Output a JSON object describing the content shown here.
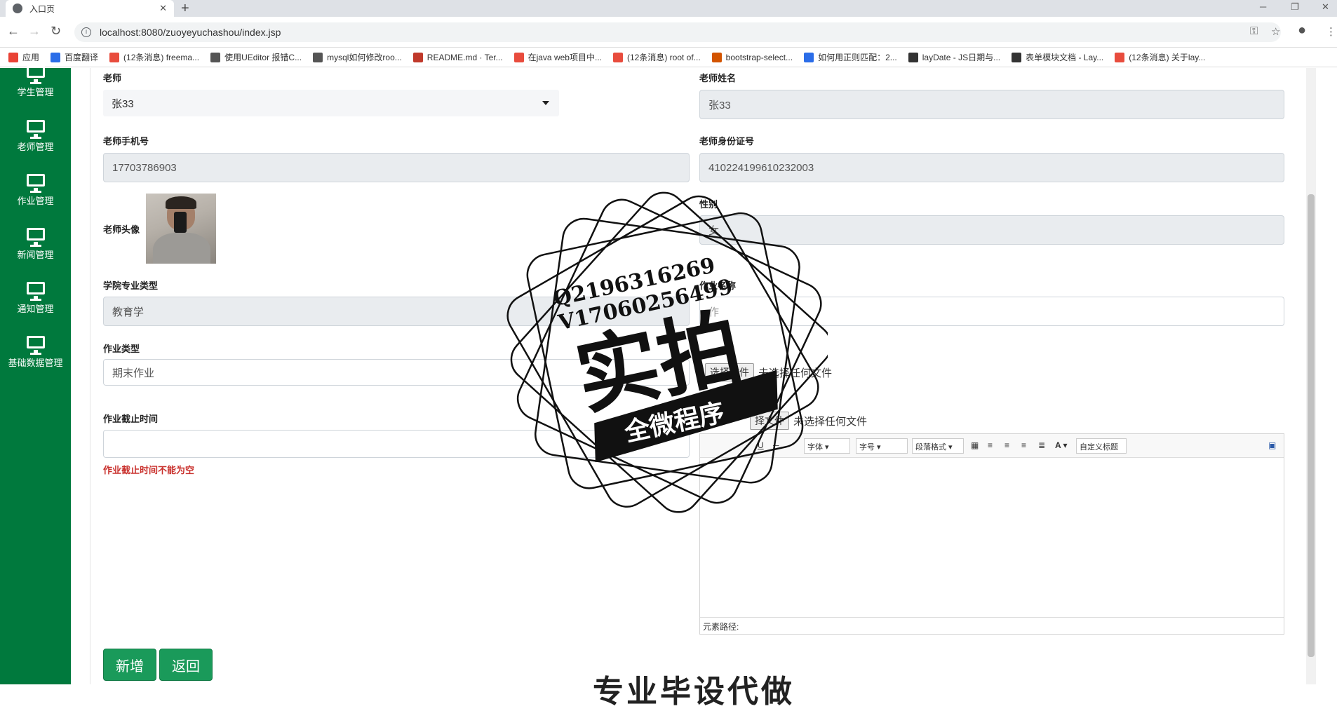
{
  "browser": {
    "tab_title": "入口页",
    "url": "localhost:8080/zuoyeyuchashou/index.jsp",
    "bookmarks": [
      {
        "label": "应用",
        "color": "#e94235"
      },
      {
        "label": "百度翻译",
        "color": "#2b6de8"
      },
      {
        "label": "(12条消息) freema...",
        "color": "#e84c3d"
      },
      {
        "label": "使用UEditor 报错C...",
        "color": "#555555"
      },
      {
        "label": "mysql如何修改roo...",
        "color": "#555555"
      },
      {
        "label": "README.md · Ter...",
        "color": "#c0392b"
      },
      {
        "label": "在java web项目中...",
        "color": "#e84c3d"
      },
      {
        "label": "(12条消息) root of...",
        "color": "#e84c3d"
      },
      {
        "label": "bootstrap-select...",
        "color": "#d35400"
      },
      {
        "label": "如何用正则匹配：2...",
        "color": "#2b6de8"
      },
      {
        "label": "layDate - JS日期与...",
        "color": "#333333"
      },
      {
        "label": "表单模块文档 - Lay...",
        "color": "#333333"
      },
      {
        "label": "(12条消息) 关于lay...",
        "color": "#e84c3d"
      }
    ]
  },
  "sidebar": {
    "items": [
      {
        "label": "学生管理"
      },
      {
        "label": "老师管理"
      },
      {
        "label": "作业管理"
      },
      {
        "label": "新闻管理"
      },
      {
        "label": "通知管理"
      },
      {
        "label": "基础数据管理"
      }
    ]
  },
  "form": {
    "teacher_label": "老师",
    "teacher_value": "张33",
    "teacher_name_label": "老师姓名",
    "teacher_name_value": "张33",
    "phone_label": "老师手机号",
    "phone_value": "17703786903",
    "idcard_label": "老师身份证号",
    "idcard_value": "410224199610232003",
    "avatar_label": "老师头像",
    "gender_label": "性别",
    "gender_value": "女",
    "major_label": "学院专业类型",
    "major_value": "教育学",
    "hw_name_label": "作业名称",
    "hw_name_placeholder": "作",
    "hw_type_label": "作业类型",
    "hw_type_value": "期末作业",
    "file1_btn": "选择文件",
    "file1_status": "未选择任何文件",
    "file2_btn": "择文件",
    "file2_status": "未选择任何文件",
    "deadline_label": "作业截止时间",
    "deadline_error": "作业截止时间不能为空",
    "editor": {
      "font_label": "字体",
      "size_label": "字号",
      "para_label": "段落格式",
      "custom_label": "自定义标题",
      "path_label": "元素路径:"
    },
    "add_button": "新增",
    "back_button": "返回"
  },
  "watermark": {
    "line1": "Q2196316269",
    "line2": "V17060256499",
    "big": "实拍",
    "banner": "全微程序",
    "bottom": "专业毕设代做"
  }
}
